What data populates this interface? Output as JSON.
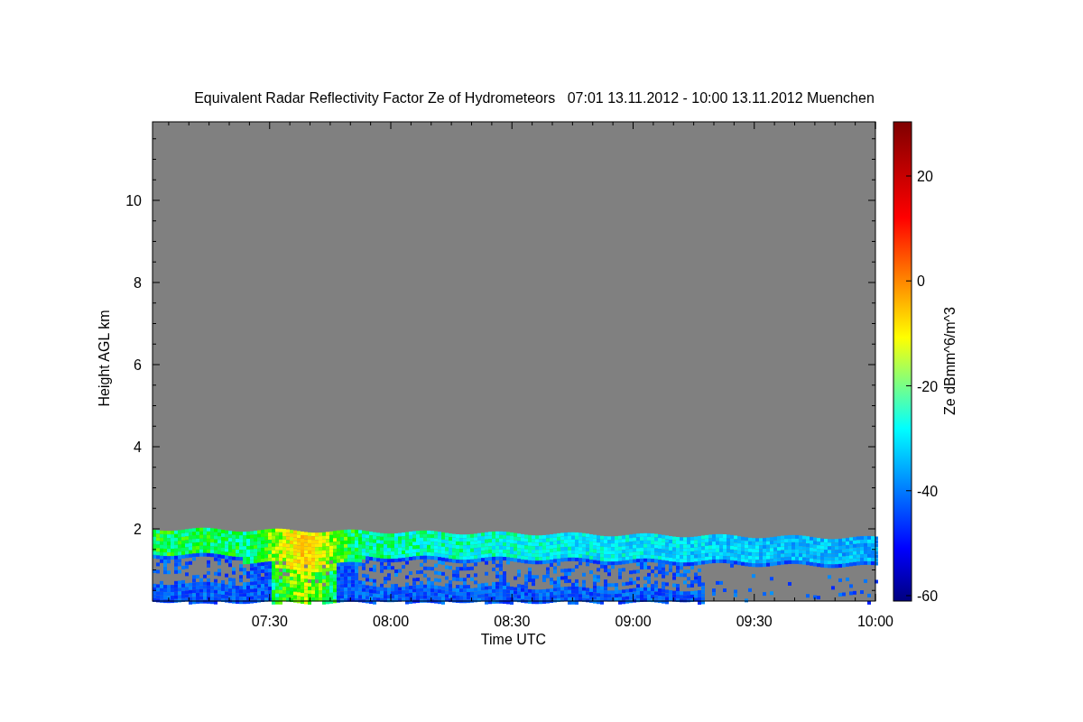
{
  "title": "Equivalent Radar Reflectivity Factor Ze of Hydrometeors   07:01 13.11.2012 - 10:00 13.11.2012 Muenchen",
  "y_axis": {
    "label": "Height AGL km",
    "ticks": [
      "10",
      "8",
      "6",
      "4",
      "2"
    ]
  },
  "x_axis": {
    "label": "Time UTC",
    "ticks": [
      "07:30",
      "08:00",
      "08:30",
      "09:00",
      "09:30",
      "10:00"
    ]
  },
  "colorbar": {
    "label": "Ze dBmm^6/m^3",
    "ticks": [
      "20",
      "0",
      "-20",
      "-40",
      "-60"
    ]
  }
}
